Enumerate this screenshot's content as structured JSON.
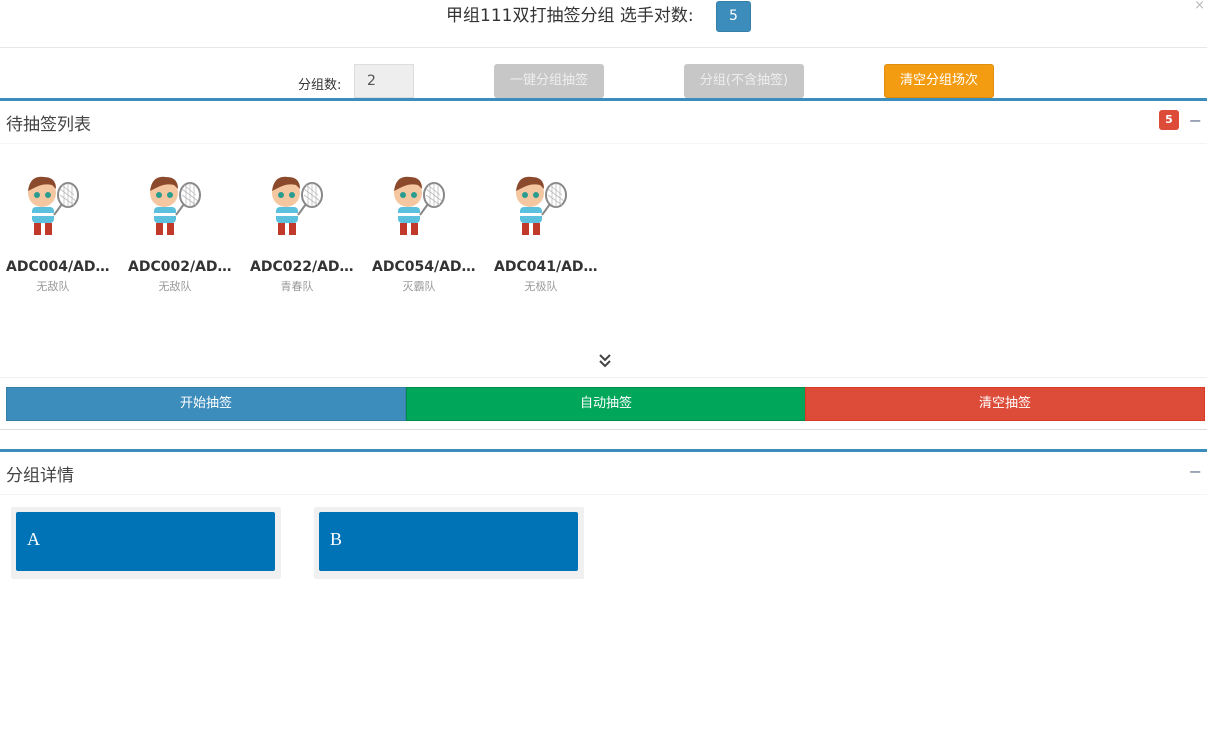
{
  "header": {
    "title": "甲组111双打抽签分组 选手对数:",
    "pair_count": "5",
    "close": "×"
  },
  "controls": {
    "group_count_label": "分组数:",
    "group_count_value": "2",
    "oneclick_label": "一键分组抽签",
    "group_nodraw_label": "分组(不含抽签)",
    "clear_schedule_label": "清空分组场次"
  },
  "draw_box": {
    "title": "待抽签列表",
    "count_badge": "5",
    "players": [
      {
        "name": "ADC004/AD...",
        "team": "无敌队"
      },
      {
        "name": "ADC002/AD...",
        "team": "无敌队"
      },
      {
        "name": "ADC022/AD...",
        "team": "青春队"
      },
      {
        "name": "ADC054/AD...",
        "team": "灭霸队"
      },
      {
        "name": "ADC041/AD...",
        "team": "无极队"
      }
    ],
    "buttons": {
      "start": "开始抽签",
      "auto": "自动抽签",
      "clear": "清空抽签"
    }
  },
  "groups_box": {
    "title": "分组详情",
    "groups": [
      {
        "label": "A"
      },
      {
        "label": "B"
      }
    ]
  },
  "colors": {
    "primary": "#3c8dbc",
    "success": "#00a65a",
    "danger": "#dd4b39",
    "warning": "#f39c12",
    "group_card": "#0073b7"
  }
}
